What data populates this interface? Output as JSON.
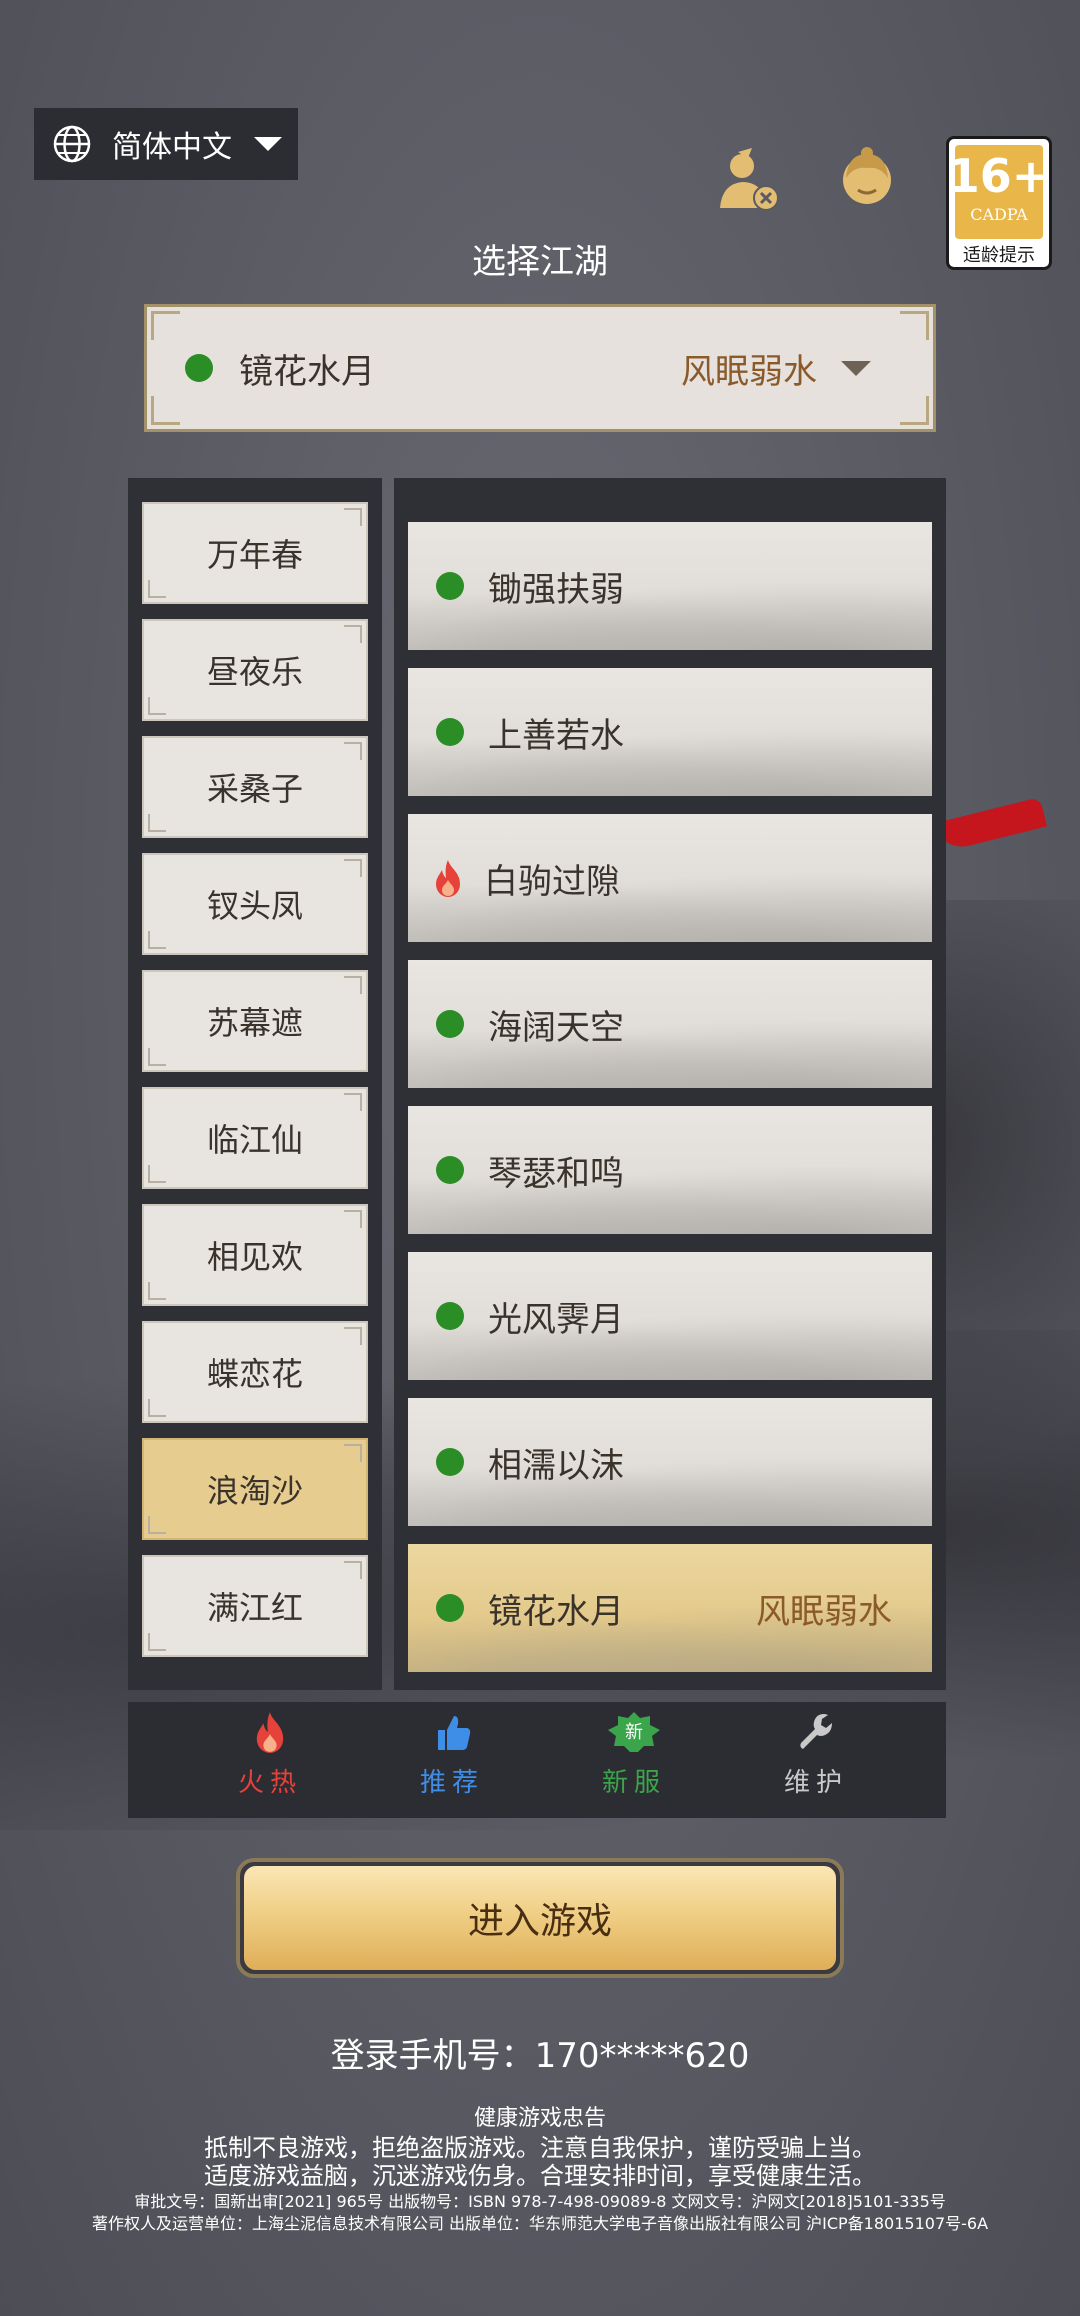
{
  "language": {
    "label": "简体中文",
    "icon": "globe-icon"
  },
  "top_icons": {
    "account": "account-switch-icon",
    "service": "customer-service-icon"
  },
  "age_rating": {
    "number": "16+",
    "org": "CADPA",
    "tip": "适龄提示"
  },
  "section_title": "选择江湖",
  "selected_server": {
    "name": "镜花水月",
    "group": "风眠弱水",
    "status_color": "#2a8d25"
  },
  "categories": [
    "万年春",
    "昼夜乐",
    "采桑子",
    "钗头凤",
    "苏幕遮",
    "临江仙",
    "相见欢",
    "蝶恋花",
    "浪淘沙",
    "满江红"
  ],
  "active_category": "浪淘沙",
  "servers": [
    {
      "name": "锄强扶弱",
      "status": "normal"
    },
    {
      "name": "上善若水",
      "status": "normal"
    },
    {
      "name": "白驹过隙",
      "status": "hot"
    },
    {
      "name": "海阔天空",
      "status": "normal"
    },
    {
      "name": "琴瑟和鸣",
      "status": "normal"
    },
    {
      "name": "光风霁月",
      "status": "normal"
    },
    {
      "name": "相濡以沫",
      "status": "normal"
    },
    {
      "name": "镜花水月",
      "status": "normal",
      "group": "风眠弱水",
      "active": true
    }
  ],
  "legend": {
    "hot": {
      "label": "火热",
      "color": "#e5433a"
    },
    "recommend": {
      "label": "推荐",
      "color": "#3e8ee8"
    },
    "new": {
      "label": "新服",
      "badge": "新",
      "color": "#3aa54a"
    },
    "maintenance": {
      "label": "维护",
      "color": "#c9c9c9"
    }
  },
  "enter_button": "进入游戏",
  "phone_login": "登录手机号：170*****620",
  "notice": {
    "title": "健康游戏忠告",
    "line1": "抵制不良游戏，拒绝盗版游戏。注意自我保护，谨防受骗上当。",
    "line2": "适度游戏益脑，沉迷游戏伤身。合理安排时间，享受健康生活。",
    "line3": "审批文号：国新出审[2021] 965号    出版物号：ISBN 978-7-498-09089-8   文网文号：沪网文[2018]5101-335号",
    "line4": "著作权人及运营单位：上海尘泥信息技术有限公司    出版单位：华东师范大学电子音像出版社有限公司    沪ICP备18015107号-6A"
  }
}
